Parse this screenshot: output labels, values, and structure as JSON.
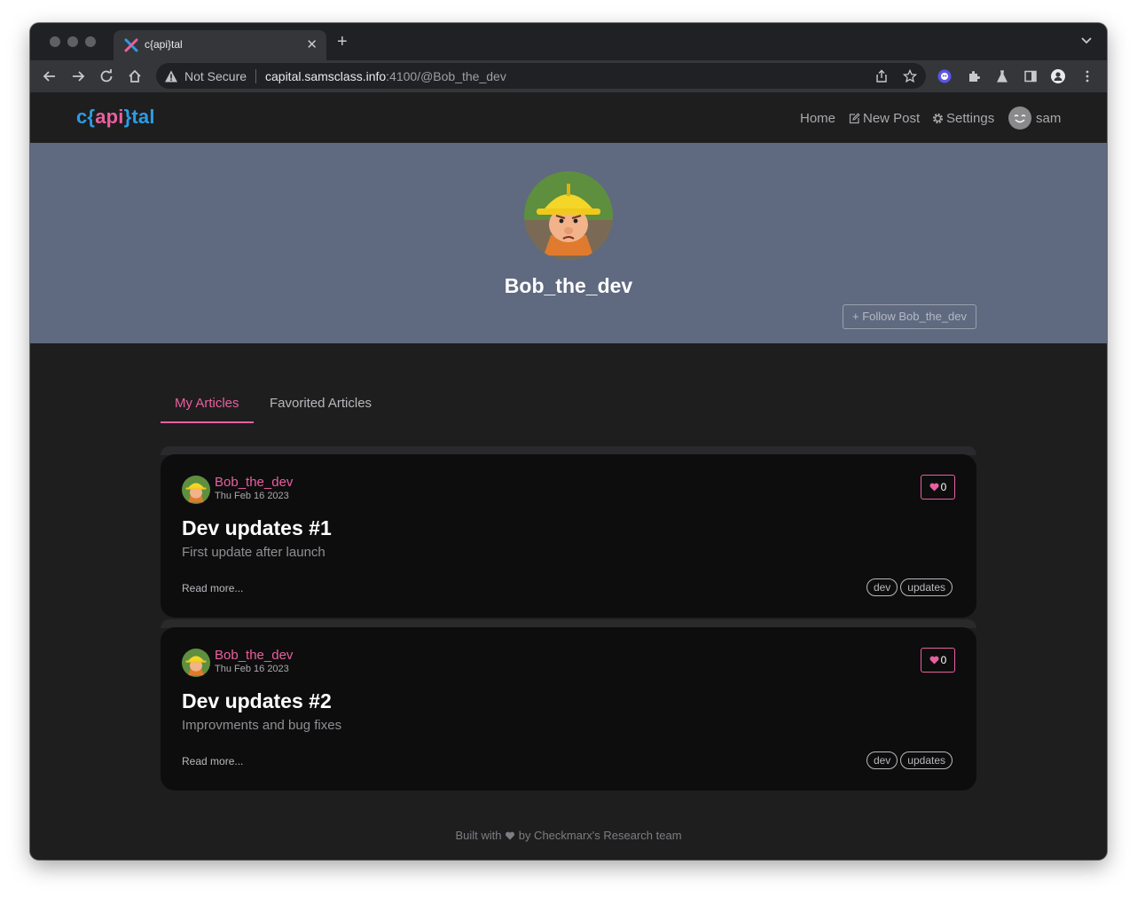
{
  "browser": {
    "tab_title": "c{api}tal",
    "not_secure": "Not Secure",
    "url_host": "capital.samsclass.info",
    "url_rest": ":4100/@Bob_the_dev"
  },
  "navbar": {
    "brand_prefix": "c{",
    "brand_api": "api",
    "brand_suffix": "}tal",
    "home": "Home",
    "new_post": "New Post",
    "settings": "Settings",
    "username": "sam"
  },
  "profile": {
    "name": "Bob_the_dev",
    "follow_label": "Follow Bob_the_dev"
  },
  "feed_tabs": {
    "my_articles": "My Articles",
    "favorited": "Favorited Articles"
  },
  "articles": [
    {
      "author": "Bob_the_dev",
      "date": "Thu Feb 16 2023",
      "title": "Dev updates #1",
      "description": "First update after launch",
      "read_more": "Read more...",
      "likes": "0",
      "tags": [
        "dev",
        "updates"
      ]
    },
    {
      "author": "Bob_the_dev",
      "date": "Thu Feb 16 2023",
      "title": "Dev updates #2",
      "description": "Improvments and bug fixes",
      "read_more": "Read more...",
      "likes": "0",
      "tags": [
        "dev",
        "updates"
      ]
    }
  ],
  "footer": {
    "prefix": "Built with",
    "suffix": "by Checkmarx's Research team"
  },
  "colors": {
    "brand_blue": "#2c9ce5",
    "accent_pink": "#e8609e",
    "banner": "#5f697f",
    "page_bg": "#1e1e1f",
    "card_bg": "#0e0d0e"
  }
}
